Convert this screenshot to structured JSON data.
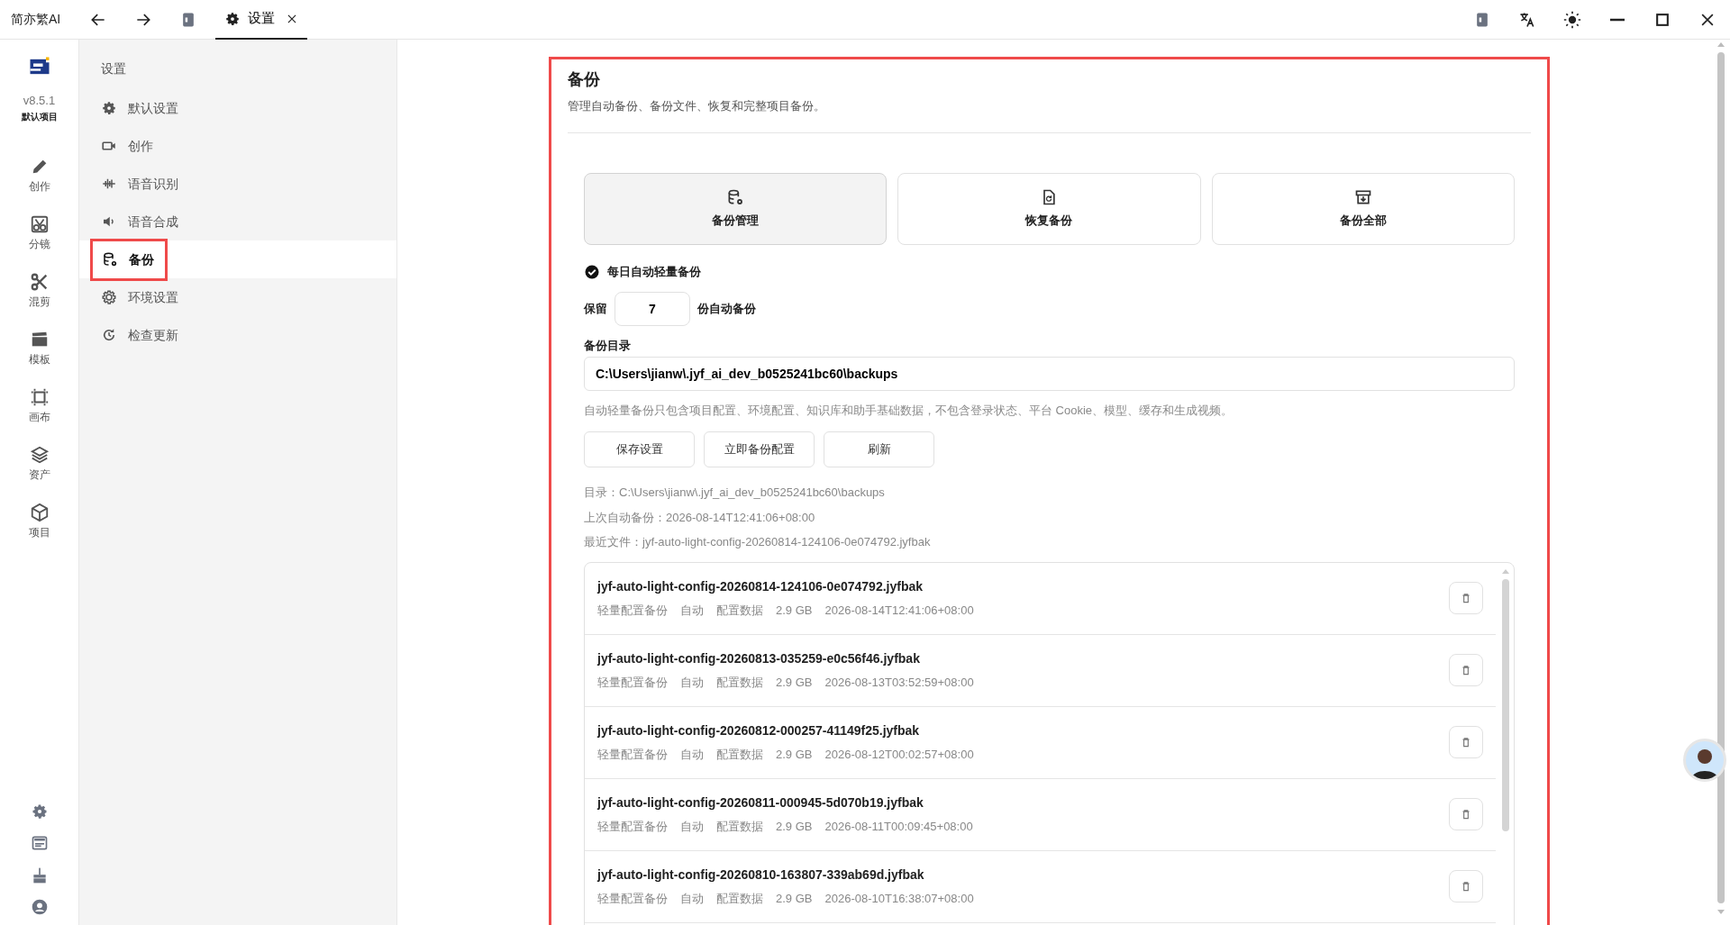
{
  "app_title": "简亦繁AI",
  "tabs": [
    {
      "label": "设置",
      "selected": true
    }
  ],
  "rail": {
    "version": "v8.5.1",
    "project": "默认项目",
    "items": [
      {
        "label": "创作"
      },
      {
        "label": "分镜"
      },
      {
        "label": "混剪"
      },
      {
        "label": "模板"
      },
      {
        "label": "画布"
      },
      {
        "label": "资产"
      },
      {
        "label": "项目"
      }
    ]
  },
  "settings_nav": {
    "heading": "设置",
    "items": [
      {
        "label": "默认设置",
        "selected": false,
        "highlighted": false
      },
      {
        "label": "创作",
        "selected": false,
        "highlighted": false
      },
      {
        "label": "语音识别",
        "selected": false,
        "highlighted": false
      },
      {
        "label": "语音合成",
        "selected": false,
        "highlighted": false
      },
      {
        "label": "备份",
        "selected": true,
        "highlighted": true
      },
      {
        "label": "环境设置",
        "selected": false,
        "highlighted": false
      },
      {
        "label": "检查更新",
        "selected": false,
        "highlighted": false
      }
    ]
  },
  "panel": {
    "highlighted": true,
    "title": "备份",
    "subtitle": "管理自动备份、备份文件、恢复和完整项目备份。",
    "modes": [
      {
        "label": "备份管理",
        "selected": true
      },
      {
        "label": "恢复备份",
        "selected": false
      },
      {
        "label": "备份全部",
        "selected": false
      }
    ],
    "auto_backup": {
      "label": "每日自动轻量备份",
      "checked": true
    },
    "keep": {
      "prefix": "保留",
      "value": "7",
      "suffix": "份自动备份"
    },
    "dir_label": "备份目录",
    "dir_value": "C:\\Users\\jianw\\.jyf_ai_dev_b0525241bc60\\backups",
    "hint": "自动轻量备份只包含项目配置、环境配置、知识库和助手基础数据，不包含登录状态、平台 Cookie、模型、缓存和生成视频。",
    "buttons": [
      "保存设置",
      "立即备份配置",
      "刷新"
    ],
    "info": [
      "目录：C:\\Users\\jianw\\.jyf_ai_dev_b0525241bc60\\backups",
      "上次自动备份：2026-08-14T12:41:06+08:00",
      "最近文件：jyf-auto-light-config-20260814-124106-0e074792.jyfbak"
    ],
    "files": [
      {
        "name": "jyf-auto-light-config-20260814-124106-0e074792.jyfbak",
        "type": "轻量配置备份",
        "mode": "自动",
        "scope": "配置数据",
        "size": "2.9 GB",
        "time": "2026-08-14T12:41:06+08:00"
      },
      {
        "name": "jyf-auto-light-config-20260813-035259-e0c56f46.jyfbak",
        "type": "轻量配置备份",
        "mode": "自动",
        "scope": "配置数据",
        "size": "2.9 GB",
        "time": "2026-08-13T03:52:59+08:00"
      },
      {
        "name": "jyf-auto-light-config-20260812-000257-41149f25.jyfbak",
        "type": "轻量配置备份",
        "mode": "自动",
        "scope": "配置数据",
        "size": "2.9 GB",
        "time": "2026-08-12T00:02:57+08:00"
      },
      {
        "name": "jyf-auto-light-config-20260811-000945-5d070b19.jyfbak",
        "type": "轻量配置备份",
        "mode": "自动",
        "scope": "配置数据",
        "size": "2.9 GB",
        "time": "2026-08-11T00:09:45+08:00"
      },
      {
        "name": "jyf-auto-light-config-20260810-163807-339ab69d.jyfbak",
        "type": "轻量配置备份",
        "mode": "自动",
        "scope": "配置数据",
        "size": "2.9 GB",
        "time": "2026-08-10T16:38:07+08:00"
      }
    ]
  }
}
